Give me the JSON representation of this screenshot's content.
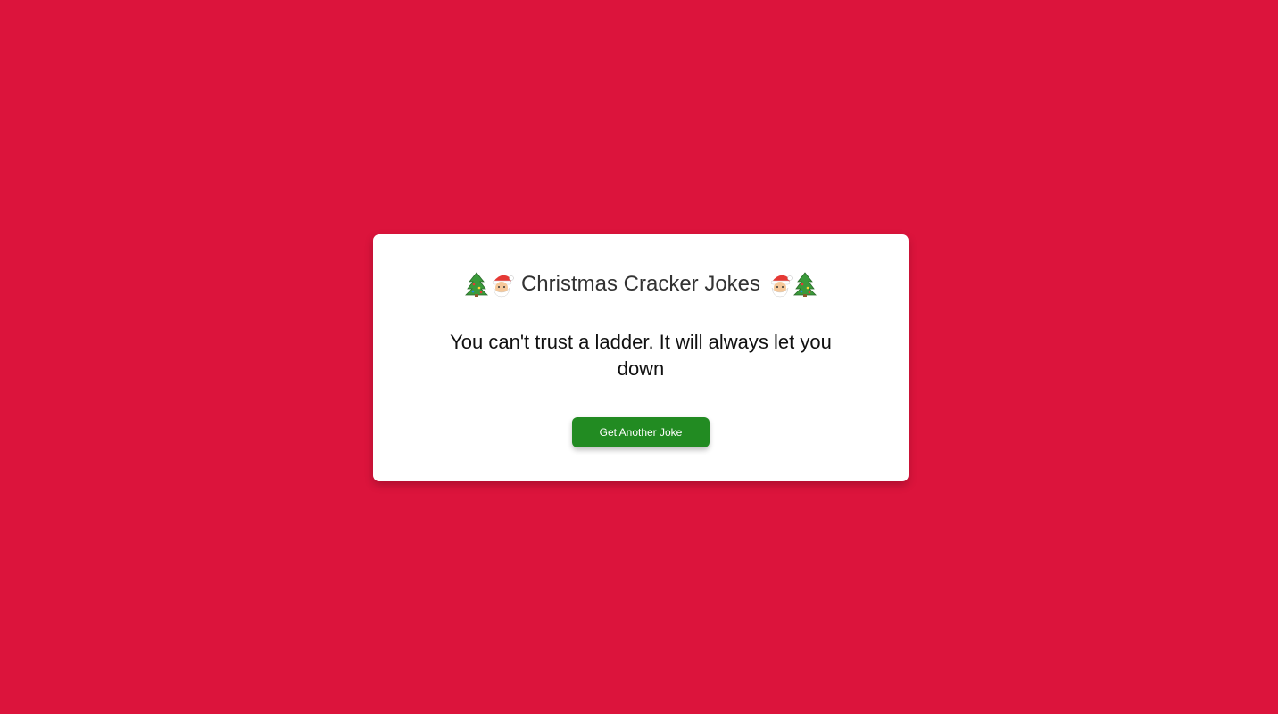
{
  "header": {
    "title": "Christmas Cracker Jokes",
    "leading_icons": [
      "christmas-tree-icon",
      "santa-icon"
    ],
    "trailing_icons": [
      "santa-icon",
      "christmas-tree-icon"
    ]
  },
  "joke": {
    "text": "You can't trust a ladder. It will always let you down"
  },
  "actions": {
    "next_joke_label": "Get Another Joke"
  },
  "colors": {
    "background": "#dc143c",
    "card": "#ffffff",
    "button": "#228b22",
    "button_text": "#ffffff"
  }
}
